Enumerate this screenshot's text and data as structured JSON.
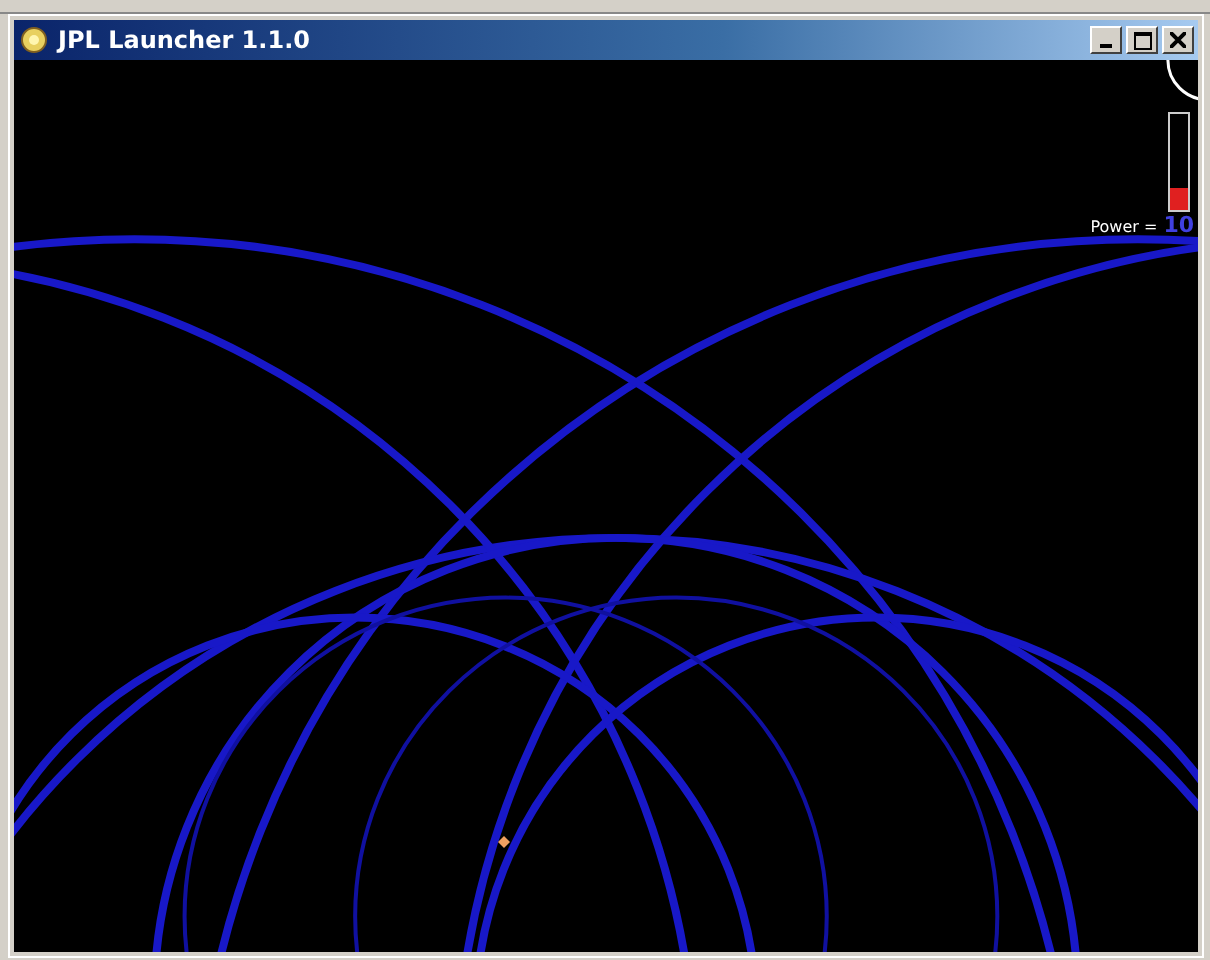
{
  "window": {
    "title": "JPL Launcher 1.1.0"
  },
  "power": {
    "label": "Power =",
    "value": "10",
    "level": 0.22
  }
}
